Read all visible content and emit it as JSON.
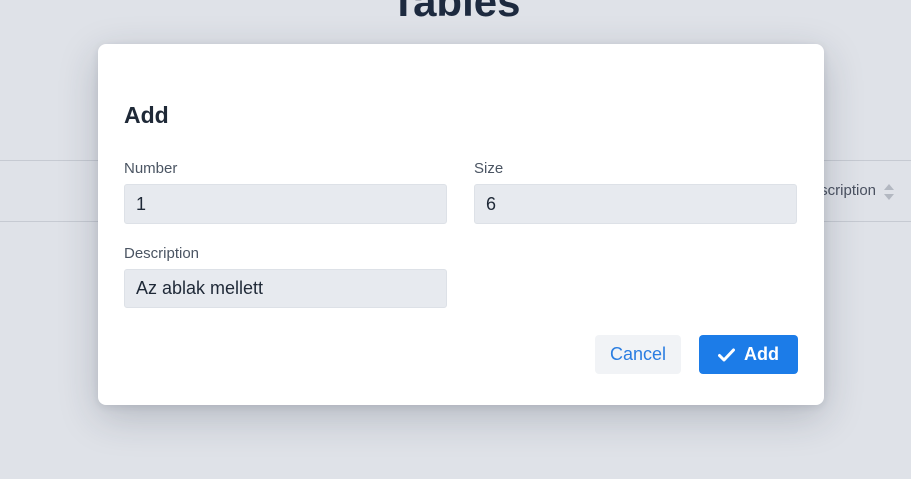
{
  "background": {
    "page_title": "Tables",
    "table_header_partial": "Description"
  },
  "modal": {
    "title": "Add",
    "fields": {
      "number": {
        "label": "Number",
        "value": "1"
      },
      "size": {
        "label": "Size",
        "value": "6"
      },
      "description": {
        "label": "Description",
        "value": "Az ablak mellett"
      }
    },
    "buttons": {
      "cancel_label": "Cancel",
      "add_label": "Add"
    }
  },
  "icons": {
    "add_button_icon": "check-icon",
    "sort_icon": "sort-icon"
  },
  "colors": {
    "primary": "#1c7ce8",
    "link": "#2a7de1",
    "input_bg": "#e7eaef",
    "backdrop": "#dfe2e8"
  }
}
